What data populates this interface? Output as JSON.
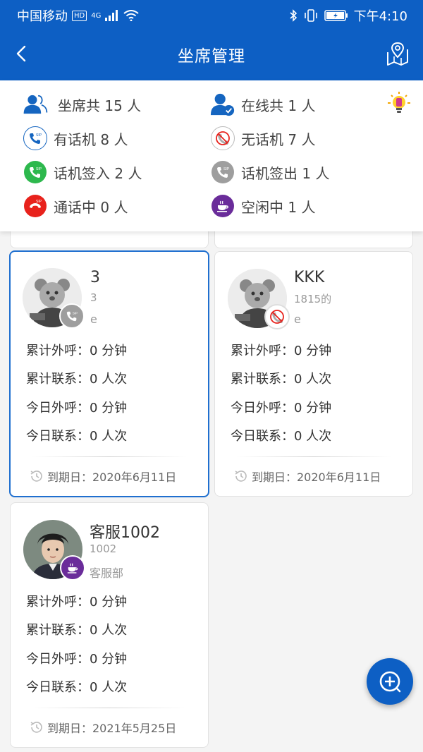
{
  "status_bar": {
    "carrier": "中国移动",
    "hd": "HD",
    "net": "4G",
    "time": "下午4:10"
  },
  "header": {
    "title": "坐席管理"
  },
  "summary": {
    "total": "坐席共 15 人",
    "online": "在线共 1 人",
    "has_phone": "有话机 8 人",
    "no_phone": "无话机 7 人",
    "signed_in": "话机签入 2 人",
    "signed_out": "话机签出 1 人",
    "in_call": "通话中 0 人",
    "idle": "空闲中 1 人"
  },
  "agents": [
    {
      "name": "3",
      "ext": "3",
      "dept": "e",
      "stats": [
        "累计外呼：0 分钟",
        "累计联系：0 人次",
        "今日外呼：0 分钟",
        "今日联系：0 人次"
      ],
      "expire": "到期日：2020年6月11日"
    },
    {
      "name": "KKK",
      "ext": "1815的",
      "dept": "e",
      "stats": [
        "累计外呼：0 分钟",
        "累计联系：0 人次",
        "今日外呼：0 分钟",
        "今日联系：0 人次"
      ],
      "expire": "到期日：2020年6月11日"
    },
    {
      "name": "客服1002",
      "ext": "1002",
      "dept": "客服部",
      "stats": [
        "累计外呼：0 分钟",
        "累计联系：0 人次",
        "今日外呼：0 分钟",
        "今日联系：0 人次"
      ],
      "expire": "到期日：2021年5月25日"
    }
  ],
  "colors": {
    "primary": "#0d5fc4",
    "green": "#2db84d",
    "red": "#e8221c",
    "gray": "#9e9e9e",
    "purple": "#6a2c9a"
  }
}
